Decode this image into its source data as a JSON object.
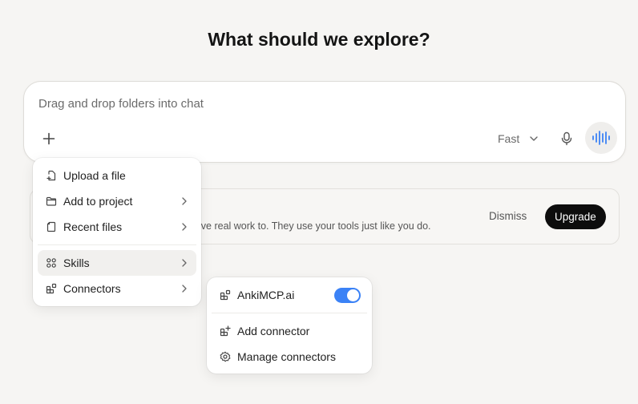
{
  "page": {
    "title": "What should we explore?"
  },
  "composer": {
    "placeholder": "Drag and drop folders into chat",
    "model_label": "Fast",
    "plus_icon": "plus-icon",
    "mic_icon": "microphone-icon",
    "voice_icon": "waveform-icon"
  },
  "banner": {
    "text": "ive real work to. They use your tools just like you do.",
    "dismiss_label": "Dismiss",
    "upgrade_label": "Upgrade"
  },
  "attach_menu": {
    "items": [
      {
        "label": "Upload a file",
        "icon": "upload-file-icon",
        "submenu": false
      },
      {
        "label": "Add to project",
        "icon": "folder-icon",
        "submenu": true
      },
      {
        "label": "Recent files",
        "icon": "recent-files-icon",
        "submenu": true
      },
      {
        "label": "Skills",
        "icon": "skills-icon",
        "submenu": true
      },
      {
        "label": "Connectors",
        "icon": "connectors-icon",
        "submenu": true
      }
    ]
  },
  "connectors_menu": {
    "connector": {
      "label": "AnkiMCP.ai",
      "icon": "connector-icon",
      "enabled": true
    },
    "add_label": "Add connector",
    "manage_label": "Manage connectors"
  },
  "colors": {
    "background": "#f6f5f3",
    "accent": "#3b82f6",
    "upgrade_bg": "#0d0d0d",
    "voice_accent": "#3b82f6"
  }
}
